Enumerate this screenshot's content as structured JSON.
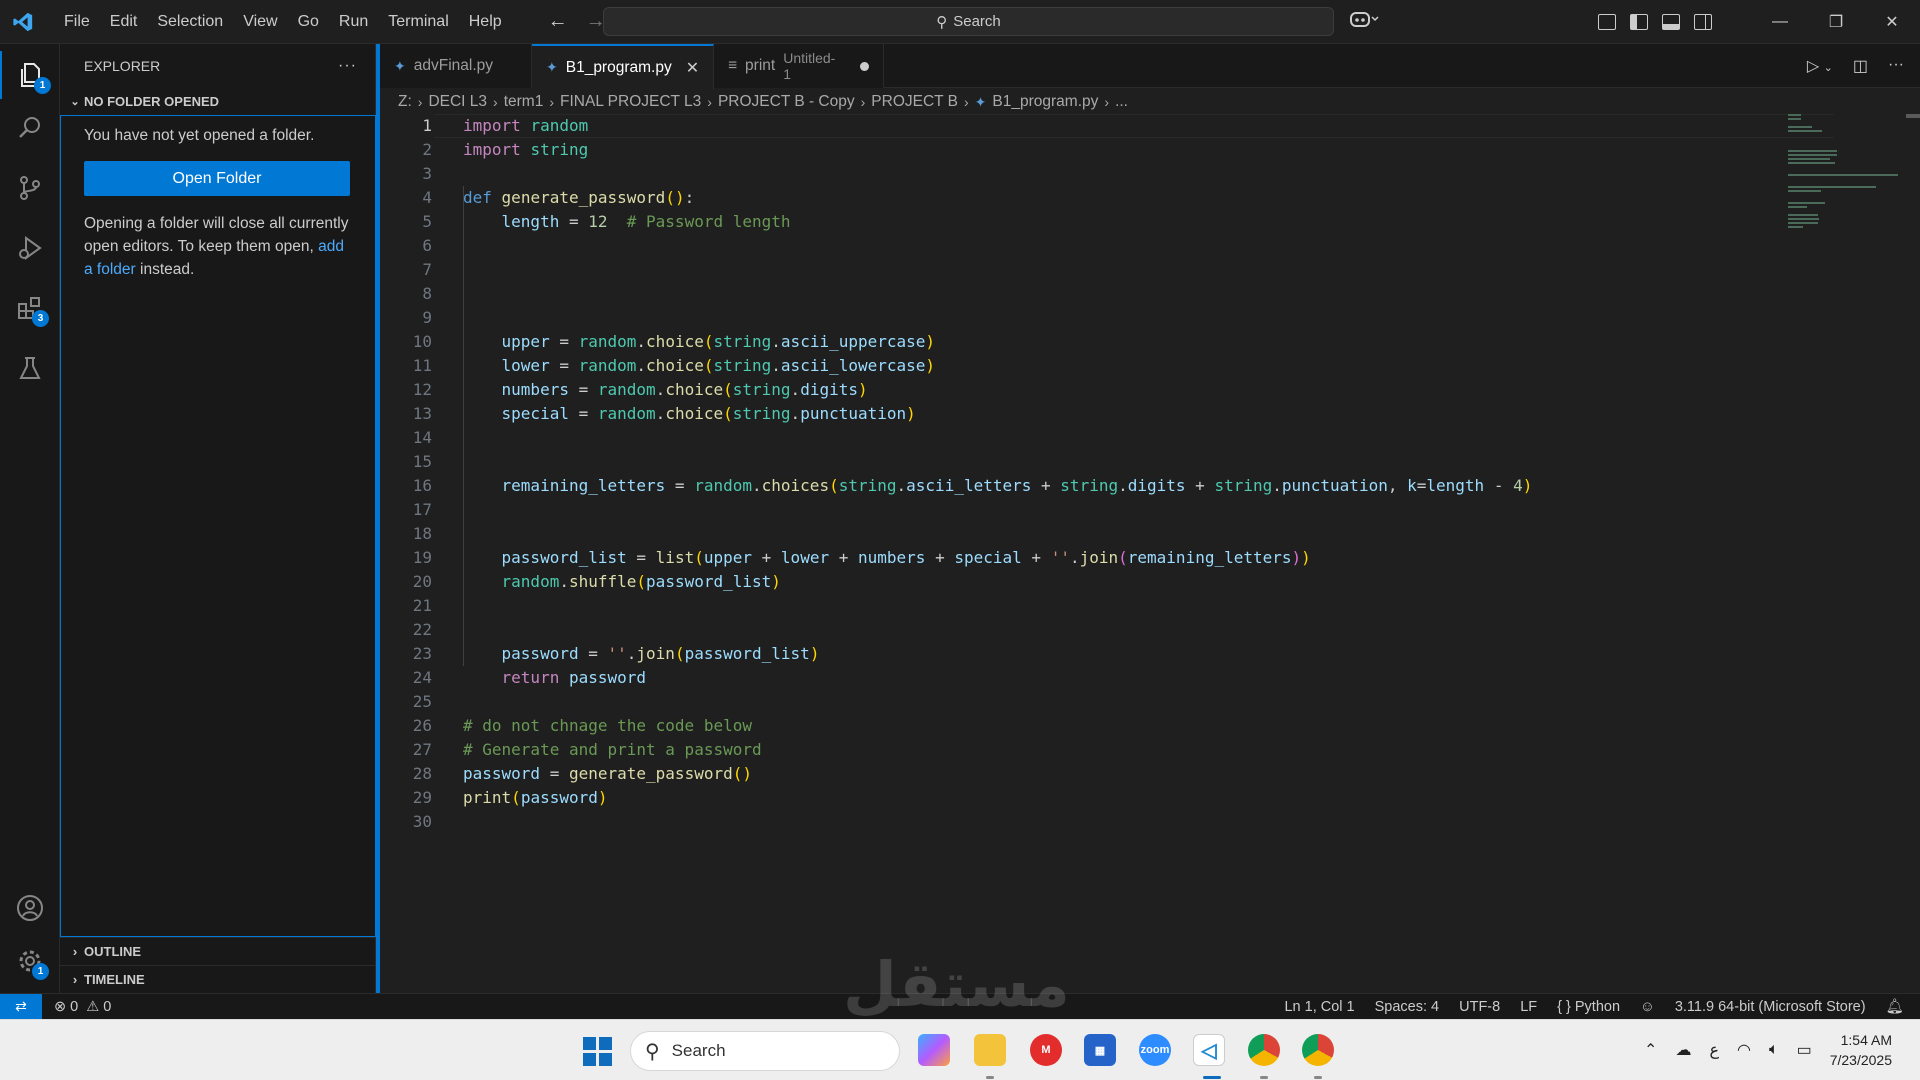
{
  "menu": [
    "File",
    "Edit",
    "Selection",
    "View",
    "Go",
    "Run",
    "Terminal",
    "Help"
  ],
  "command_center": {
    "label": "Search"
  },
  "explorer": {
    "title": "EXPLORER",
    "more": "···",
    "section": "NO FOLDER OPENED",
    "message": "You have not yet opened a folder.",
    "open_button": "Open Folder",
    "hint_start": "Opening a folder will close all currently open editors. To keep them open, ",
    "hint_link": "add a folder",
    "hint_end": " instead.",
    "outline": "OUTLINE",
    "timeline": "TIMELINE"
  },
  "activity_badges": {
    "explorer": "1",
    "extensions": "3",
    "settings": "1"
  },
  "tabs": [
    {
      "label": "advFinal.py",
      "icon": "python-icon"
    },
    {
      "label": "B1_program.py",
      "icon": "python-icon",
      "active": true
    },
    {
      "label": "print",
      "sub": "Untitled-1",
      "icon": "text-lines-icon",
      "dirty": true
    }
  ],
  "breadcrumb": [
    "Z:",
    "DECI L3",
    "term1",
    "FINAL PROJECT L3",
    "PROJECT B - Copy",
    "PROJECT B",
    "B1_program.py",
    "..."
  ],
  "code_lines": [
    "import random",
    "import string",
    "",
    "def generate_password():",
    "    length = 12  # Password length",
    "",
    "",
    "",
    "",
    "    upper = random.choice(string.ascii_uppercase)",
    "    lower = random.choice(string.ascii_lowercase)",
    "    numbers = random.choice(string.digits)",
    "    special = random.choice(string.punctuation)",
    "",
    "",
    "    remaining_letters = random.choices(string.ascii_letters + string.digits + string.punctuation, k=length - 4)",
    "",
    "",
    "    password_list = list(upper + lower + numbers + special + ''.join(remaining_letters))",
    "    random.shuffle(password_list)",
    "",
    "",
    "    password = ''.join(password_list)",
    "    return password",
    "",
    "# do not chnage the code below",
    "# Generate and print a password",
    "password = generate_password()",
    "print(password)",
    ""
  ],
  "status": {
    "errors": "0",
    "warnings": "0",
    "position": "Ln 1, Col 1",
    "spaces": "Spaces: 4",
    "encoding": "UTF-8",
    "eol": "LF",
    "language": "Python",
    "interpreter": "3.11.9 64-bit (Microsoft Store)"
  },
  "taskbar": {
    "search_label": "Search",
    "time": "1:54 AM",
    "date": "7/23/2025",
    "input_lang": "ع"
  },
  "colors": {
    "accent": "#0078d4",
    "keyword": "#c586c0",
    "function": "#dcdcaa",
    "variable": "#9cdcfe",
    "comment": "#6a9955",
    "string": "#ce9178"
  }
}
